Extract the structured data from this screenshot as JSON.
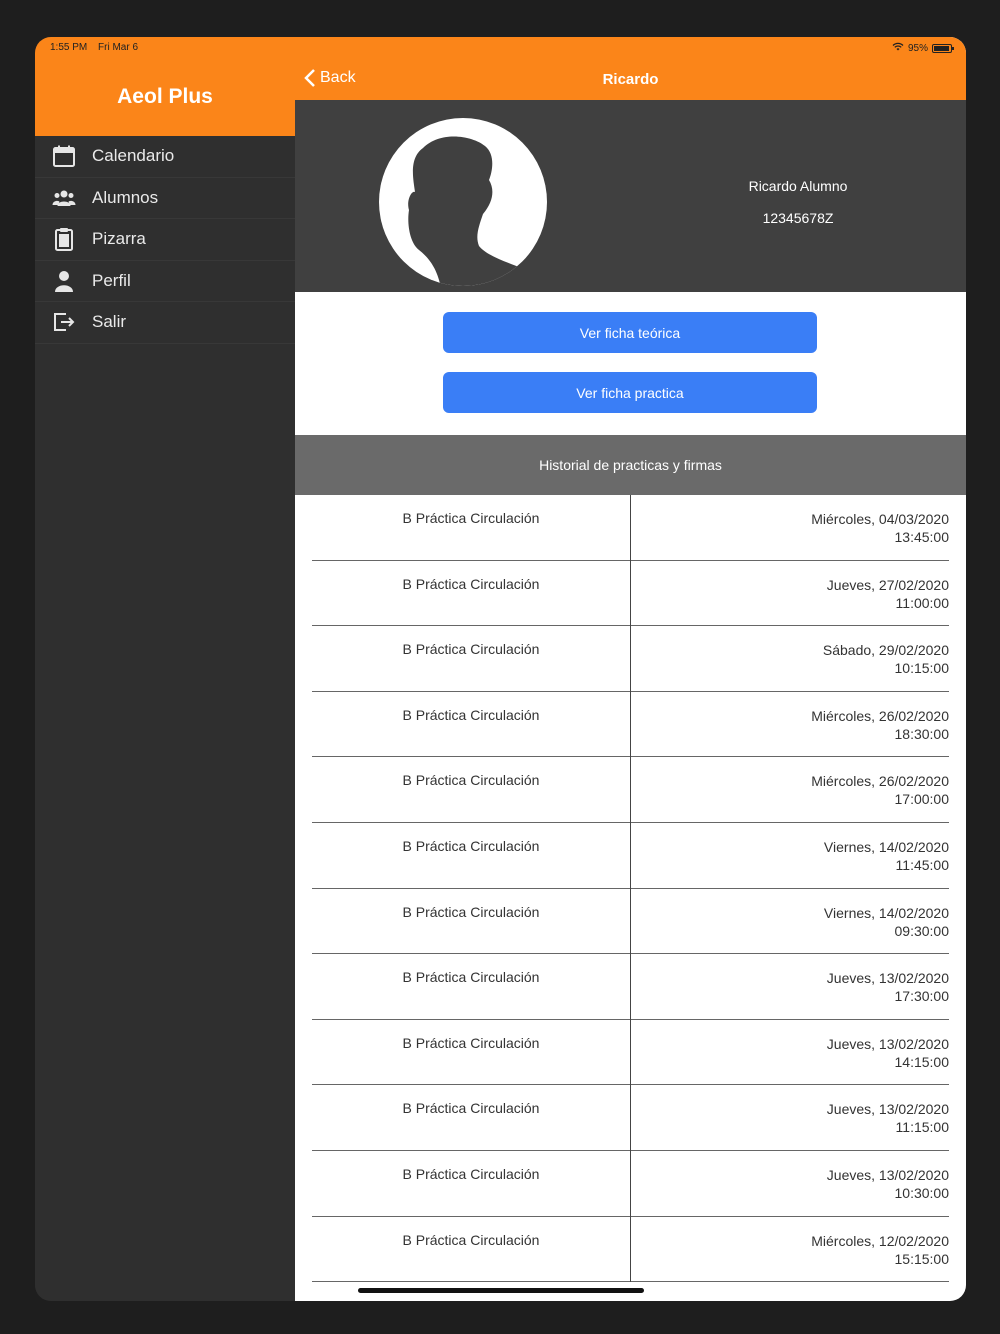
{
  "status": {
    "time": "1:55 PM",
    "date": "Fri Mar 6",
    "battery": "95%"
  },
  "sidebar": {
    "title": "Aeol Plus",
    "items": [
      {
        "label": "Calendario",
        "icon": "calendar-icon"
      },
      {
        "label": "Alumnos",
        "icon": "users-icon"
      },
      {
        "label": "Pizarra",
        "icon": "clipboard-icon"
      },
      {
        "label": "Perfil",
        "icon": "person-icon"
      },
      {
        "label": "Salir",
        "icon": "logout-icon"
      }
    ]
  },
  "navbar": {
    "back_label": "Back",
    "title": "Ricardo"
  },
  "profile": {
    "name": "Ricardo Alumno",
    "id": "12345678Z"
  },
  "actions": {
    "theory_label": "Ver ficha teórica",
    "practice_label": "Ver ficha practica"
  },
  "history": {
    "header": "Historial de practicas y firmas",
    "rows": [
      {
        "type": "B Práctica Circulación",
        "date": "Miércoles, 04/03/2020",
        "time": "13:45:00"
      },
      {
        "type": "B Práctica Circulación",
        "date": "Jueves, 27/02/2020",
        "time": "11:00:00"
      },
      {
        "type": "B Práctica Circulación",
        "date": "Sábado, 29/02/2020",
        "time": "10:15:00"
      },
      {
        "type": "B Práctica Circulación",
        "date": "Miércoles, 26/02/2020",
        "time": "18:30:00"
      },
      {
        "type": "B Práctica Circulación",
        "date": "Miércoles, 26/02/2020",
        "time": "17:00:00"
      },
      {
        "type": "B Práctica Circulación",
        "date": "Viernes, 14/02/2020",
        "time": "11:45:00"
      },
      {
        "type": "B Práctica Circulación",
        "date": "Viernes, 14/02/2020",
        "time": "09:30:00"
      },
      {
        "type": "B Práctica Circulación",
        "date": "Jueves, 13/02/2020",
        "time": "17:30:00"
      },
      {
        "type": "B Práctica Circulación",
        "date": "Jueves, 13/02/2020",
        "time": "14:15:00"
      },
      {
        "type": "B Práctica Circulación",
        "date": "Jueves, 13/02/2020",
        "time": "11:15:00"
      },
      {
        "type": "B Práctica Circulación",
        "date": "Jueves, 13/02/2020",
        "time": "10:30:00"
      },
      {
        "type": "B Práctica Circulación",
        "date": "Miércoles, 12/02/2020",
        "time": "15:15:00"
      }
    ]
  },
  "colors": {
    "accent": "#fb8519",
    "button": "#3a7ef6",
    "sidebar": "#2f2f2f",
    "profile_bg": "#404040",
    "section_header": "#6a6a6a"
  }
}
